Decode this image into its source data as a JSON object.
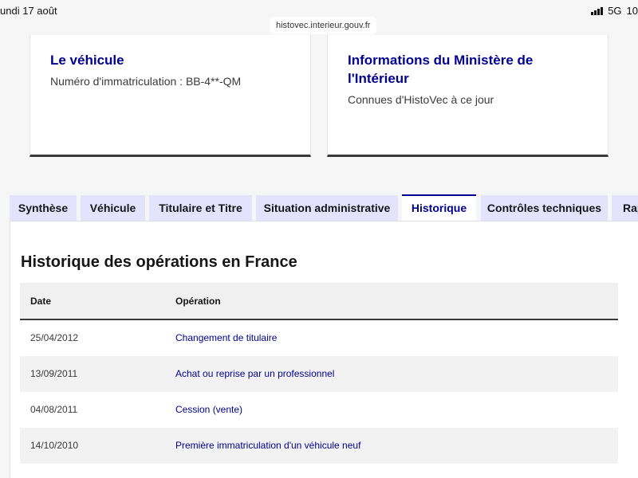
{
  "status_bar": {
    "date": "undi 17 août",
    "network": "5G",
    "battery": "10"
  },
  "browser": {
    "url": "histovec.interieur.gouv.fr"
  },
  "cards": [
    {
      "title": "Le véhicule",
      "desc": "Numéro d'immatriculation : BB-4**-QM"
    },
    {
      "title": "Informations du Ministère de l'Intérieur",
      "desc": "Connues d'HistoVec à ce jour"
    }
  ],
  "tabs": [
    {
      "label": "Synthèse",
      "active": false
    },
    {
      "label": "Véhicule",
      "active": false
    },
    {
      "label": "Titulaire et Titre",
      "active": false
    },
    {
      "label": "Situation administrative",
      "active": false
    },
    {
      "label": "Historique",
      "active": true
    },
    {
      "label": "Contrôles techniques",
      "active": false
    },
    {
      "label": "Rap",
      "active": false
    }
  ],
  "panel": {
    "title": "Historique des opérations en France"
  },
  "table": {
    "headers": {
      "date": "Date",
      "operation": "Opération"
    },
    "rows": [
      {
        "date": "25/04/2012",
        "operation": "Changement de titulaire"
      },
      {
        "date": "13/09/2011",
        "operation": "Achat ou reprise par un professionnel"
      },
      {
        "date": "04/08/2011",
        "operation": "Cession (vente)"
      },
      {
        "date": "14/10/2010",
        "operation": "Première immatriculation d'un véhicule neuf"
      }
    ]
  },
  "colors": {
    "accent": "#000091",
    "tab_bg": "#e3e3fd"
  }
}
